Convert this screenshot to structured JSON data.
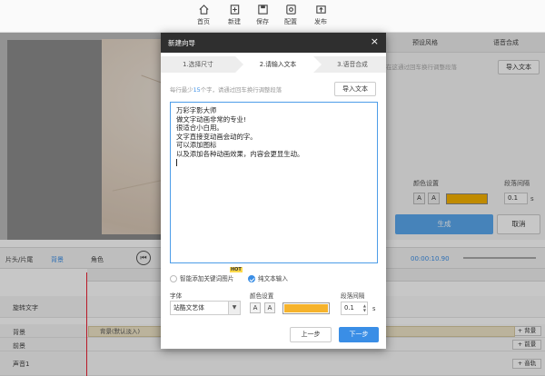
{
  "toolbar": {
    "items": [
      {
        "label": "首页",
        "icon": "home-icon"
      },
      {
        "label": "新建",
        "icon": "new-file-icon"
      },
      {
        "label": "保存",
        "icon": "save-icon"
      },
      {
        "label": "配置",
        "icon": "settings-icon"
      },
      {
        "label": "发布",
        "icon": "publish-icon"
      }
    ]
  },
  "right_panel": {
    "tabs": [
      "预设风格",
      "语音合成"
    ],
    "hint": "在这通过回车换行调整段落",
    "import_label": "导入文本",
    "color_label": "颜色设置",
    "spacing_label": "段落间隔",
    "spacing_value": "0.1",
    "spacing_unit": "s",
    "generate_label": "生成",
    "cancel_label": "取消",
    "color_value": "#f6b300"
  },
  "timeline": {
    "tools": [
      "片头/片尾",
      "背景",
      "角色"
    ],
    "time_current": "00:00:10.90",
    "tracks": [
      {
        "label": "旋转文字",
        "add": ""
      },
      {
        "label": "背景",
        "add": "+ 背景"
      },
      {
        "label": "前景",
        "add": "+ 前景"
      },
      {
        "label": "声音1",
        "add": "+ 音轨"
      }
    ],
    "bg_clip_label": "背景(默认淡入)"
  },
  "modal": {
    "title": "新建向导",
    "close": "×",
    "steps": [
      "1.选择尺寸",
      "2.请输入文本",
      "3.语音合成"
    ],
    "hint_prefix": "每行最少",
    "hint_num": "15",
    "hint_suffix": "个字，请通过回车换行调整段落",
    "import_label": "导入文本",
    "text_lines": [
      "万彩字影大师",
      "做文字动画非常的专业!",
      "很适合小白用。",
      "文字直接变动画会动的字。",
      "可以添加图标",
      "以及添加各种动画效果，内容会更显生动。"
    ],
    "option_smart": "智能添加关键词图片",
    "option_hot": "HOT",
    "option_plain": "纯文本输入",
    "font_label": "字体",
    "font_value": "站酷文艺体",
    "color_label": "颜色设置",
    "color_value": "#f6b32c",
    "spacing_label": "段落间隔",
    "spacing_value": "0.1",
    "spacing_unit": "s",
    "prev_label": "上一步",
    "next_label": "下一步"
  }
}
